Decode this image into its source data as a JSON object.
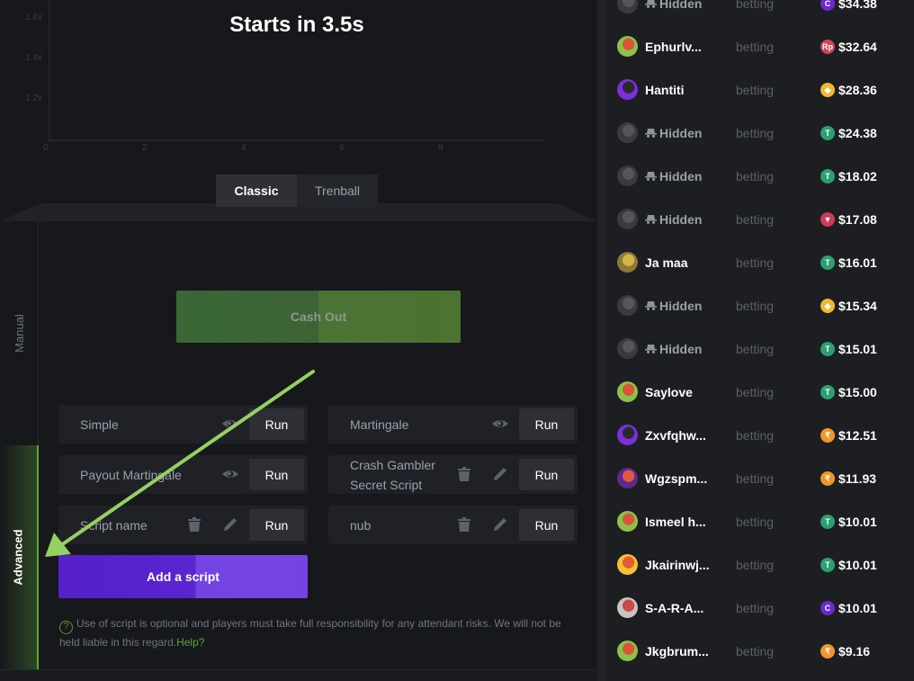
{
  "game": {
    "countdown": "Starts in 3.5s",
    "chart": {
      "y_ticks": [
        "1.6x",
        "1.4x",
        "1.2x"
      ],
      "x_ticks": [
        "0",
        "2",
        "4",
        "6",
        "8"
      ]
    },
    "mode_tabs": [
      {
        "label": "Classic",
        "active": true
      },
      {
        "label": "Trenball",
        "active": false
      }
    ]
  },
  "controls": {
    "side_tabs": [
      {
        "label": "Manual",
        "active": false
      },
      {
        "label": "Advanced",
        "active": true
      }
    ],
    "cash_out_label": "Cash Out",
    "scripts": [
      {
        "name": "Simple",
        "icons": [
          "eye-icon"
        ],
        "run_label": "Run"
      },
      {
        "name": "Martingale",
        "icons": [
          "eye-icon"
        ],
        "run_label": "Run"
      },
      {
        "name": "Payout Martingale",
        "icons": [
          "eye-icon"
        ],
        "run_label": "Run"
      },
      {
        "name": "Crash Gambler Secret Script",
        "icons": [
          "trash-icon",
          "pencil-icon"
        ],
        "run_label": "Run"
      },
      {
        "name": "Script name",
        "icons": [
          "trash-icon",
          "pencil-icon"
        ],
        "run_label": "Run"
      },
      {
        "name": "nub",
        "icons": [
          "trash-icon",
          "pencil-icon"
        ],
        "run_label": "Run"
      }
    ],
    "add_script_label": "Add a script",
    "disclaimer": {
      "text": "Use of script is optional and players must take full responsibility for any attendant risks. We will not be held liable in this regard.",
      "help_link": "Help?"
    }
  },
  "players": [
    {
      "name": "Hidden",
      "hidden": true,
      "status": "betting",
      "amount": "$34.38",
      "coin": "cfx",
      "avatar": "hidden"
    },
    {
      "name": "Ephurlv...",
      "hidden": false,
      "status": "betting",
      "amount": "$32.64",
      "coin": "idr",
      "avatar": "green"
    },
    {
      "name": "Hantiti",
      "hidden": false,
      "status": "betting",
      "amount": "$28.36",
      "coin": "bnb",
      "avatar": "purple"
    },
    {
      "name": "Hidden",
      "hidden": true,
      "status": "betting",
      "amount": "$24.38",
      "coin": "usdt",
      "avatar": "hidden"
    },
    {
      "name": "Hidden",
      "hidden": true,
      "status": "betting",
      "amount": "$18.02",
      "coin": "usdt",
      "avatar": "hidden"
    },
    {
      "name": "Hidden",
      "hidden": true,
      "status": "betting",
      "amount": "$17.08",
      "coin": "trx",
      "avatar": "hidden"
    },
    {
      "name": "Ja maa",
      "hidden": false,
      "status": "betting",
      "amount": "$16.01",
      "coin": "usdt",
      "avatar": "gold"
    },
    {
      "name": "Hidden",
      "hidden": true,
      "status": "betting",
      "amount": "$15.34",
      "coin": "bnb",
      "avatar": "hidden"
    },
    {
      "name": "Hidden",
      "hidden": true,
      "status": "betting",
      "amount": "$15.01",
      "coin": "usdt",
      "avatar": "hidden"
    },
    {
      "name": "Saylove",
      "hidden": false,
      "status": "betting",
      "amount": "$15.00",
      "coin": "usdt",
      "avatar": "green"
    },
    {
      "name": "Zxvfqhw...",
      "hidden": false,
      "status": "betting",
      "amount": "$12.51",
      "coin": "inr",
      "avatar": "purple"
    },
    {
      "name": "Wgzspm...",
      "hidden": false,
      "status": "betting",
      "amount": "$11.93",
      "coin": "inr",
      "avatar": "redpurple"
    },
    {
      "name": "Ismeel h...",
      "hidden": false,
      "status": "betting",
      "amount": "$10.01",
      "coin": "usdt",
      "avatar": "green"
    },
    {
      "name": "Jkairinwj...",
      "hidden": false,
      "status": "betting",
      "amount": "$10.01",
      "coin": "usdt",
      "avatar": "yellow"
    },
    {
      "name": "S-A-R-A...",
      "hidden": false,
      "status": "betting",
      "amount": "$10.01",
      "coin": "cfx",
      "avatar": "photo"
    },
    {
      "name": "Jkgbrum...",
      "hidden": false,
      "status": "betting",
      "amount": "$9.16",
      "coin": "inr",
      "avatar": "green"
    }
  ],
  "colors": {
    "accent_green": "#5ea63a",
    "accent_purple": "#6a35dc",
    "background": "#17181b",
    "panel": "#1d1e22",
    "annotation_arrow": "#95d062"
  }
}
